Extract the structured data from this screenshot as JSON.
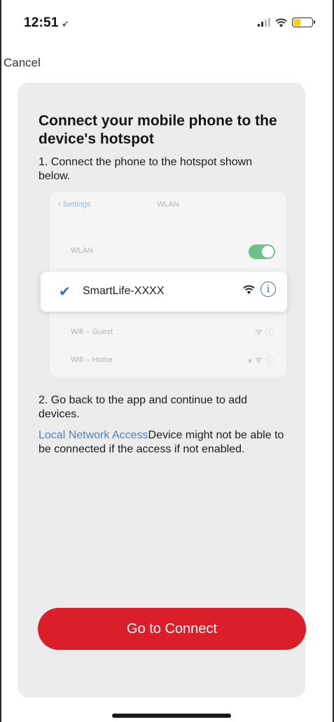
{
  "status_bar": {
    "time": "12:51",
    "location_icon": "location-arrow-icon",
    "signal_icon": "cellular-signal-icon",
    "wifi_icon": "wifi-icon",
    "battery_icon": "battery-icon",
    "battery_level": 0.35,
    "battery_color": "#f2d21c"
  },
  "nav": {
    "cancel_label": "Cancel"
  },
  "card": {
    "title": "Connect your mobile phone to the device's hotspot",
    "step1": "1. Connect the phone to the hotspot shown below.",
    "illustration": {
      "back_label": "Settings",
      "nav_title": "WLAN",
      "wlan_label": "WLAN",
      "wlan_toggle_on": true,
      "selected_network": "SmartLife-XXXX",
      "other_networks": [
        {
          "name": "Wifi – Guest",
          "locked": false
        },
        {
          "name": "Wifi – Home",
          "locked": true
        }
      ]
    },
    "step2": "2. Go back to the app and continue to add devices.",
    "local_network_link": "Local Network Access",
    "local_network_text": "Device might not be able to be connected if the access if not enabled."
  },
  "actions": {
    "connect_label": "Go to Connect"
  },
  "colors": {
    "accent_red": "#da1f2b",
    "link_blue": "#4d82c4",
    "check_blue": "#2f6fc9",
    "toggle_green": "#6cc38a"
  }
}
